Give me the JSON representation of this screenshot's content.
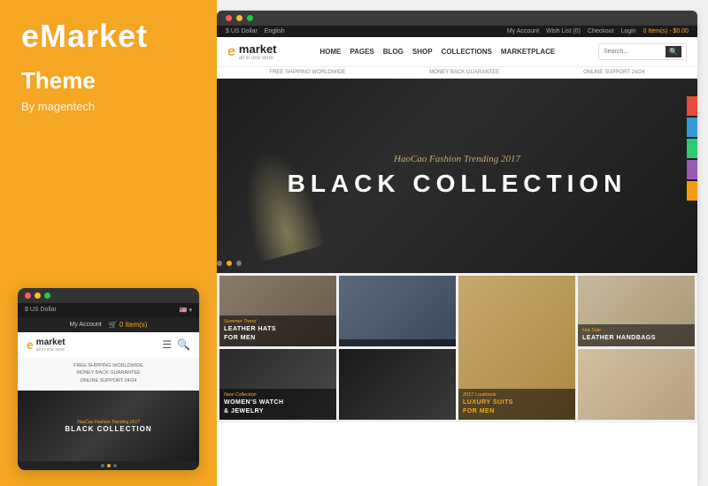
{
  "left": {
    "brand": "eMarket",
    "theme_label": "Theme",
    "by_label": "By magentech"
  },
  "mobile": {
    "currency": "$ US Dollar",
    "flag": "🇺🇸",
    "my_account": "My Account",
    "cart": "0 Item(s)",
    "logo_text": "market",
    "logo_sub": "all in one store",
    "info_lines": [
      "FREE SHIPPING WORLDWIDE",
      "MONEY BACK GUARANTEE",
      "ONLINE SUPPORT 24/24"
    ],
    "hero_sub": "HaoCao Fashion Trending 2017",
    "hero_main": "BLACK COLLECTION"
  },
  "desktop": {
    "currency": "$ US Dollar",
    "language": "English",
    "my_account": "My Account",
    "wish_list": "Wish List (0)",
    "checkout": "Checkout",
    "login": "Login",
    "cart_label": "0 Item(s) - $0.00",
    "logo_text": "market",
    "logo_sub": "all in one store",
    "nav_items": [
      "HOME",
      "PAGES",
      "BLOG",
      "SHOP",
      "COLLECTIONS",
      "MARKETPLACE"
    ],
    "search_placeholder": "Search...",
    "info_items": [
      "FREE SHIPPING WORLDWIDE",
      "MONEY BACK GUARANTEE",
      "ONLINE SUPPORT 24/24"
    ],
    "hero_sub": "HaoCao Fashion Trending 2017",
    "hero_main": "BLACK COLLECTION"
  },
  "products": [
    {
      "tag": "",
      "title": "LEATHER HATS\nFOR MEN",
      "style": "prod-cell-1",
      "overlay": true,
      "tag_text": "Summer Trend"
    },
    {
      "tag": "",
      "title": "LUXURY SUITS\nFOR MEN",
      "style": "prod-cell-6",
      "overlay": true,
      "tag_text": "2017 Lookbook",
      "highlighted": true
    },
    {
      "tag": "",
      "title": "",
      "style": "prod-cell-3",
      "overlay": false
    },
    {
      "tag": "",
      "title": "LEATHER HANDBAGS",
      "style": "prod-cell-4",
      "overlay": true,
      "tag_text": "Hot Sale"
    },
    {
      "tag": "",
      "title": "WOMEN'S WATCH\n& JEWELRY",
      "style": "prod-cell-5",
      "overlay": true,
      "tag_text": "New Collection"
    },
    {
      "tag": "",
      "title": "",
      "style": "prod-cell-7",
      "overlay": false
    },
    {
      "tag": "",
      "title": "",
      "style": "prod-cell-8",
      "overlay": false
    },
    {
      "tag": "",
      "title": "",
      "style": "prod-cell-2",
      "overlay": false
    }
  ],
  "dots": [
    "dot1",
    "dot2",
    "dot3"
  ],
  "side_tabs": [
    "#ff6b35",
    "#4caf50",
    "#2196f3",
    "#9c27b0",
    "#ff9800"
  ]
}
